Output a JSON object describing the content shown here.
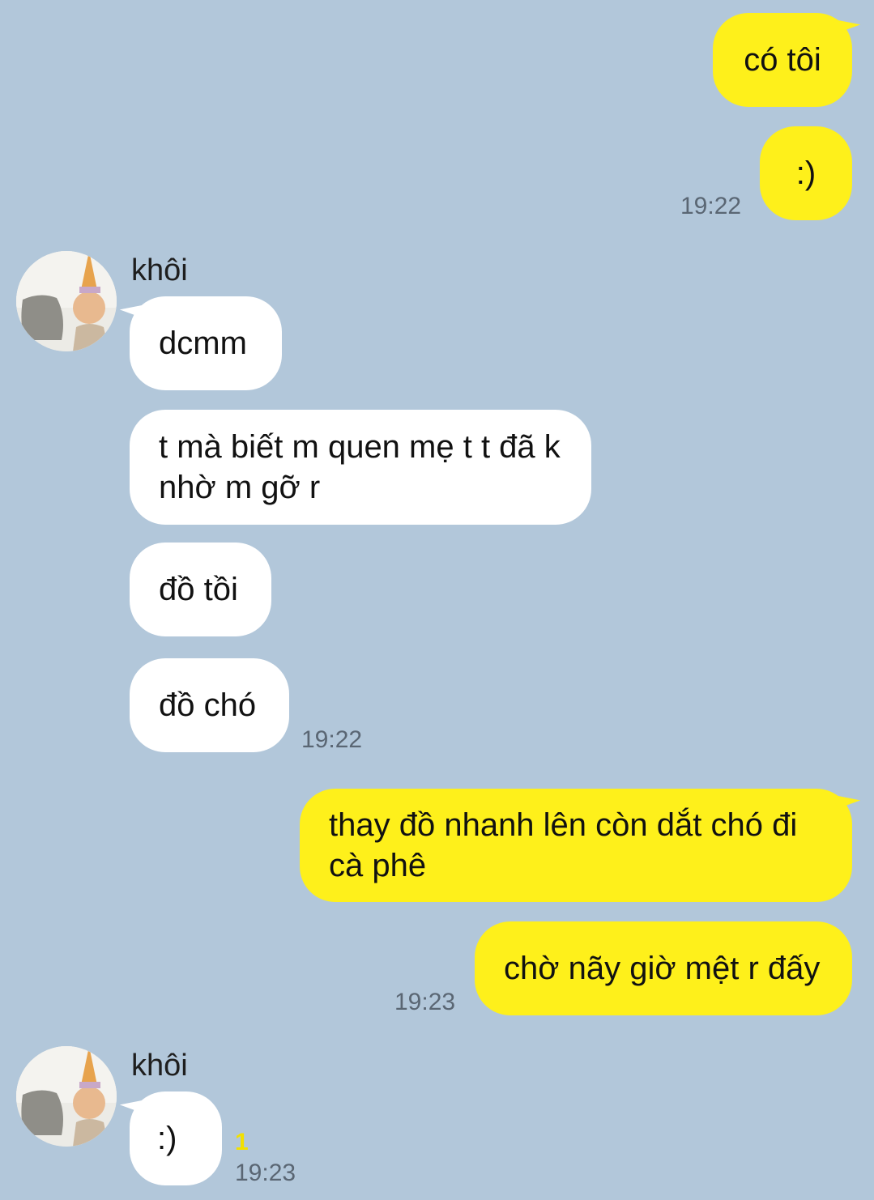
{
  "colors": {
    "background": "#b2c7da",
    "my_bubble": "#fef01b",
    "their_bubble": "#ffffff",
    "timestamp": "#5a6673",
    "unread": "#f2e000"
  },
  "messages": {
    "m1": {
      "text": "có tôi"
    },
    "m2": {
      "text": ":)",
      "time": "19:22"
    },
    "group1": {
      "sender": "khôi",
      "avatar": "avatar-photo-icon"
    },
    "m3": {
      "text": "dcmm"
    },
    "m4": {
      "text": "t mà biết m quen mẹ t t đã k nhờ m gỡ r"
    },
    "m5": {
      "text": "đồ tồi"
    },
    "m6": {
      "text": "đồ chó",
      "time": "19:22"
    },
    "m7": {
      "text": "thay đồ nhanh lên còn dắt chó đi cà phê"
    },
    "m8": {
      "text": "chờ nãy giờ mệt r đấy",
      "time": "19:23"
    },
    "group2": {
      "sender": "khôi",
      "avatar": "avatar-photo-icon"
    },
    "m9": {
      "text": ":)",
      "time": "19:23",
      "unread": "1"
    }
  }
}
